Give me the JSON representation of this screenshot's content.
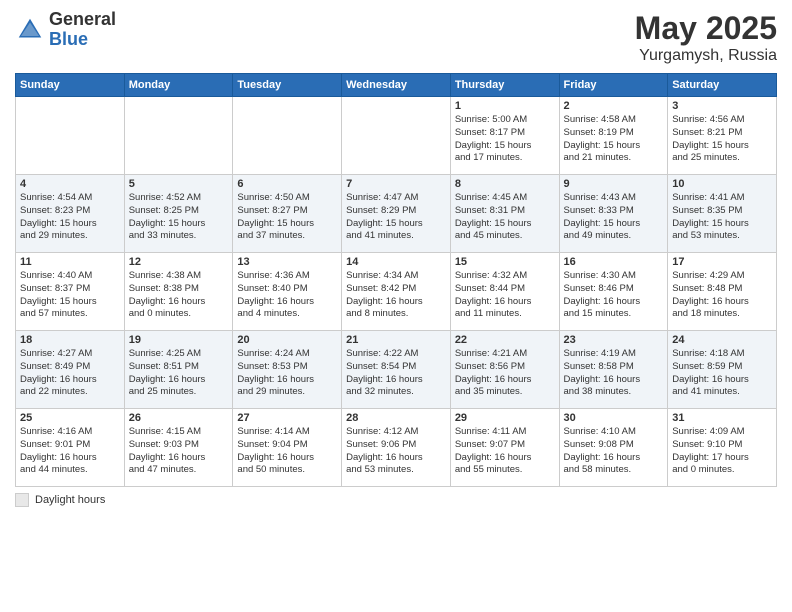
{
  "header": {
    "logo": {
      "general": "General",
      "blue": "Blue"
    },
    "title": "May 2025",
    "location": "Yurgamysh, Russia"
  },
  "days_of_week": [
    "Sunday",
    "Monday",
    "Tuesday",
    "Wednesday",
    "Thursday",
    "Friday",
    "Saturday"
  ],
  "weeks": [
    [
      {
        "day": "",
        "info": ""
      },
      {
        "day": "",
        "info": ""
      },
      {
        "day": "",
        "info": ""
      },
      {
        "day": "",
        "info": ""
      },
      {
        "day": "1",
        "info": "Sunrise: 5:00 AM\nSunset: 8:17 PM\nDaylight: 15 hours\nand 17 minutes."
      },
      {
        "day": "2",
        "info": "Sunrise: 4:58 AM\nSunset: 8:19 PM\nDaylight: 15 hours\nand 21 minutes."
      },
      {
        "day": "3",
        "info": "Sunrise: 4:56 AM\nSunset: 8:21 PM\nDaylight: 15 hours\nand 25 minutes."
      }
    ],
    [
      {
        "day": "4",
        "info": "Sunrise: 4:54 AM\nSunset: 8:23 PM\nDaylight: 15 hours\nand 29 minutes."
      },
      {
        "day": "5",
        "info": "Sunrise: 4:52 AM\nSunset: 8:25 PM\nDaylight: 15 hours\nand 33 minutes."
      },
      {
        "day": "6",
        "info": "Sunrise: 4:50 AM\nSunset: 8:27 PM\nDaylight: 15 hours\nand 37 minutes."
      },
      {
        "day": "7",
        "info": "Sunrise: 4:47 AM\nSunset: 8:29 PM\nDaylight: 15 hours\nand 41 minutes."
      },
      {
        "day": "8",
        "info": "Sunrise: 4:45 AM\nSunset: 8:31 PM\nDaylight: 15 hours\nand 45 minutes."
      },
      {
        "day": "9",
        "info": "Sunrise: 4:43 AM\nSunset: 8:33 PM\nDaylight: 15 hours\nand 49 minutes."
      },
      {
        "day": "10",
        "info": "Sunrise: 4:41 AM\nSunset: 8:35 PM\nDaylight: 15 hours\nand 53 minutes."
      }
    ],
    [
      {
        "day": "11",
        "info": "Sunrise: 4:40 AM\nSunset: 8:37 PM\nDaylight: 15 hours\nand 57 minutes."
      },
      {
        "day": "12",
        "info": "Sunrise: 4:38 AM\nSunset: 8:38 PM\nDaylight: 16 hours\nand 0 minutes."
      },
      {
        "day": "13",
        "info": "Sunrise: 4:36 AM\nSunset: 8:40 PM\nDaylight: 16 hours\nand 4 minutes."
      },
      {
        "day": "14",
        "info": "Sunrise: 4:34 AM\nSunset: 8:42 PM\nDaylight: 16 hours\nand 8 minutes."
      },
      {
        "day": "15",
        "info": "Sunrise: 4:32 AM\nSunset: 8:44 PM\nDaylight: 16 hours\nand 11 minutes."
      },
      {
        "day": "16",
        "info": "Sunrise: 4:30 AM\nSunset: 8:46 PM\nDaylight: 16 hours\nand 15 minutes."
      },
      {
        "day": "17",
        "info": "Sunrise: 4:29 AM\nSunset: 8:48 PM\nDaylight: 16 hours\nand 18 minutes."
      }
    ],
    [
      {
        "day": "18",
        "info": "Sunrise: 4:27 AM\nSunset: 8:49 PM\nDaylight: 16 hours\nand 22 minutes."
      },
      {
        "day": "19",
        "info": "Sunrise: 4:25 AM\nSunset: 8:51 PM\nDaylight: 16 hours\nand 25 minutes."
      },
      {
        "day": "20",
        "info": "Sunrise: 4:24 AM\nSunset: 8:53 PM\nDaylight: 16 hours\nand 29 minutes."
      },
      {
        "day": "21",
        "info": "Sunrise: 4:22 AM\nSunset: 8:54 PM\nDaylight: 16 hours\nand 32 minutes."
      },
      {
        "day": "22",
        "info": "Sunrise: 4:21 AM\nSunset: 8:56 PM\nDaylight: 16 hours\nand 35 minutes."
      },
      {
        "day": "23",
        "info": "Sunrise: 4:19 AM\nSunset: 8:58 PM\nDaylight: 16 hours\nand 38 minutes."
      },
      {
        "day": "24",
        "info": "Sunrise: 4:18 AM\nSunset: 8:59 PM\nDaylight: 16 hours\nand 41 minutes."
      }
    ],
    [
      {
        "day": "25",
        "info": "Sunrise: 4:16 AM\nSunset: 9:01 PM\nDaylight: 16 hours\nand 44 minutes."
      },
      {
        "day": "26",
        "info": "Sunrise: 4:15 AM\nSunset: 9:03 PM\nDaylight: 16 hours\nand 47 minutes."
      },
      {
        "day": "27",
        "info": "Sunrise: 4:14 AM\nSunset: 9:04 PM\nDaylight: 16 hours\nand 50 minutes."
      },
      {
        "day": "28",
        "info": "Sunrise: 4:12 AM\nSunset: 9:06 PM\nDaylight: 16 hours\nand 53 minutes."
      },
      {
        "day": "29",
        "info": "Sunrise: 4:11 AM\nSunset: 9:07 PM\nDaylight: 16 hours\nand 55 minutes."
      },
      {
        "day": "30",
        "info": "Sunrise: 4:10 AM\nSunset: 9:08 PM\nDaylight: 16 hours\nand 58 minutes."
      },
      {
        "day": "31",
        "info": "Sunrise: 4:09 AM\nSunset: 9:10 PM\nDaylight: 17 hours\nand 0 minutes."
      }
    ]
  ],
  "footer": {
    "daylight_label": "Daylight hours"
  }
}
